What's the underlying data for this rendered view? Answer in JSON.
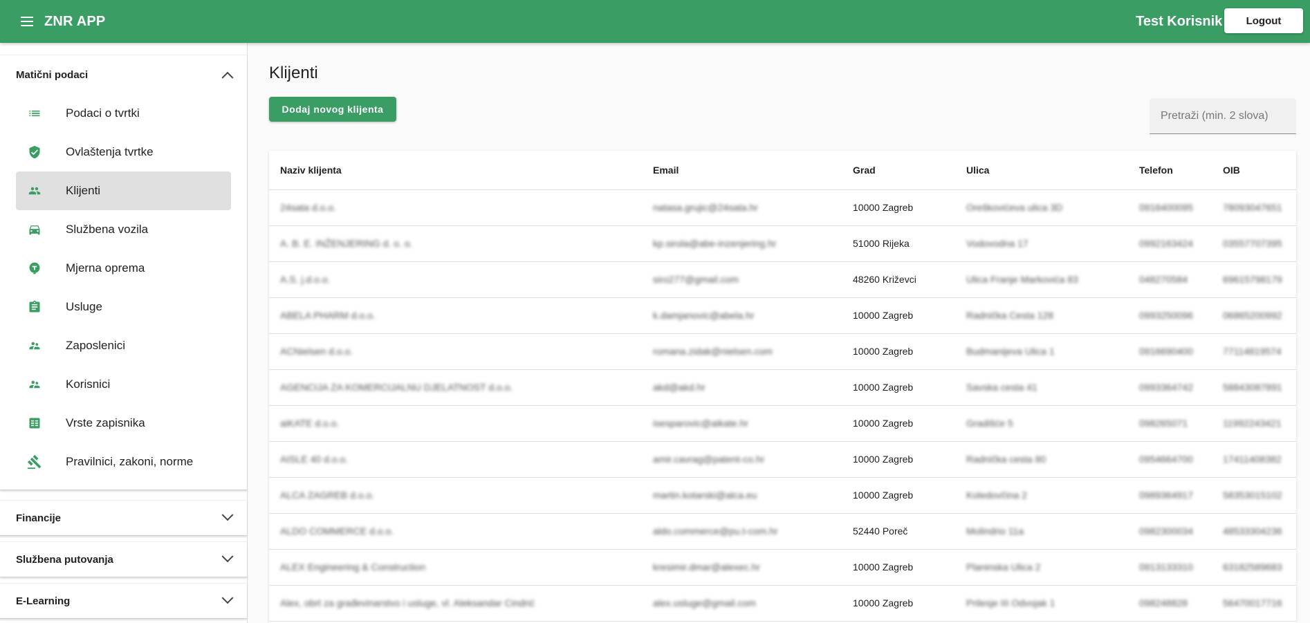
{
  "appbar": {
    "title": "ZNR APP",
    "user": "Test Korisnik 2",
    "logout_label": "Logout"
  },
  "colors": {
    "primary": "#3a9e64"
  },
  "sidebar": {
    "sections": [
      {
        "title": "Matični podaci",
        "expanded": true
      },
      {
        "title": "Financije",
        "expanded": false
      },
      {
        "title": "Službena putovanja",
        "expanded": false
      },
      {
        "title": "E-Learning",
        "expanded": false
      }
    ],
    "items": [
      {
        "label": "Podaci o tvrtki",
        "icon": "list-icon"
      },
      {
        "label": "Ovlaštenja tvrtke",
        "icon": "shield-check-icon"
      },
      {
        "label": "Klijenti",
        "icon": "people-icon",
        "active": true
      },
      {
        "label": "Službena vozila",
        "icon": "car-icon"
      },
      {
        "label": "Mjerna oprema",
        "icon": "gauge-icon"
      },
      {
        "label": "Usluge",
        "icon": "clipboard-icon"
      },
      {
        "label": "Zaposlenici",
        "icon": "people-icon"
      },
      {
        "label": "Korisnici",
        "icon": "people-icon"
      },
      {
        "label": "Vrste zapisnika",
        "icon": "list-box-icon"
      },
      {
        "label": "Pravilnici, zakoni, norme",
        "icon": "gavel-icon"
      }
    ]
  },
  "main": {
    "title": "Klijenti",
    "add_label": "Dodaj novog klijenta",
    "search_placeholder": "Pretraži (min. 2 slova)",
    "columns": [
      "Naziv klijenta",
      "Email",
      "Grad",
      "Ulica",
      "Telefon",
      "OIB"
    ],
    "rows": [
      [
        "24sata d.o.o.",
        "natasa.grujic@24sata.hr",
        "10000 Zagreb",
        "Oreškovićeva ulica 3D",
        "0916400095",
        "78093047651"
      ],
      [
        "A. B. E. INŽENJERING d. o. o.",
        "kp.sirola@abe-inzenjering.hr",
        "51000 Rijeka",
        "Vodovodna 17",
        "0992163424",
        "03557707395"
      ],
      [
        "A.S. j.d.o.o.",
        "siro277@gmail.com",
        "48260 Križevci",
        "Ulica Franje Markovića 83",
        "048270584",
        "69615798179"
      ],
      [
        "ABELA PHARM d.o.o.",
        "k.damjanovic@abela.hr",
        "10000 Zagreb",
        "Radnička Cesta 128",
        "0993250096",
        "06865200992"
      ],
      [
        "ACNielsen d.o.o.",
        "romana.zidak@nielsen.com",
        "10000 Zagreb",
        "Budmanijeva Ulica 1",
        "0916690400",
        "77114819574"
      ],
      [
        "AGENCIJA ZA KOMERCIJALNU DJELATNOST d.o.o.",
        "akd@akd.hr",
        "10000 Zagreb",
        "Savska cesta 41",
        "0993364742",
        "58843087891"
      ],
      [
        "aiKATE d.o.o.",
        "isesparovic@aikate.hr",
        "10000 Zagreb",
        "Gradišće 5",
        "098265071",
        "11992243421"
      ],
      [
        "AISLE 40 d.o.o.",
        "amir.cavrag@patent-co.hr",
        "10000 Zagreb",
        "Radnička cesta 80",
        "0954664700",
        "17411408382"
      ],
      [
        "ALCA ZAGREB d.o.o.",
        "martin.kotarski@alca.eu",
        "10000 Zagreb",
        "Koledovčina 2",
        "0989364917",
        "58353015102"
      ],
      [
        "ALDO COMMERCE d.o.o.",
        "aldo.commerce@pu.t-com.hr",
        "52440 Poreč",
        "Molindrio 11a",
        "0982300034",
        "48533304236"
      ],
      [
        "ALEX Engineering & Construction",
        "kresimir.dmar@alexec.hr",
        "10000 Zagreb",
        "Planinska Ulica 2",
        "0913133310",
        "63182589683"
      ],
      [
        "Alex, obrt za građevinarstvo i usluge, vl. Aleksandar Cindrić",
        "alex.usluge@gmail.com",
        "10000 Zagreb",
        "Prilesje III Odvojak 1",
        "098248828",
        "56470017716"
      ]
    ]
  }
}
